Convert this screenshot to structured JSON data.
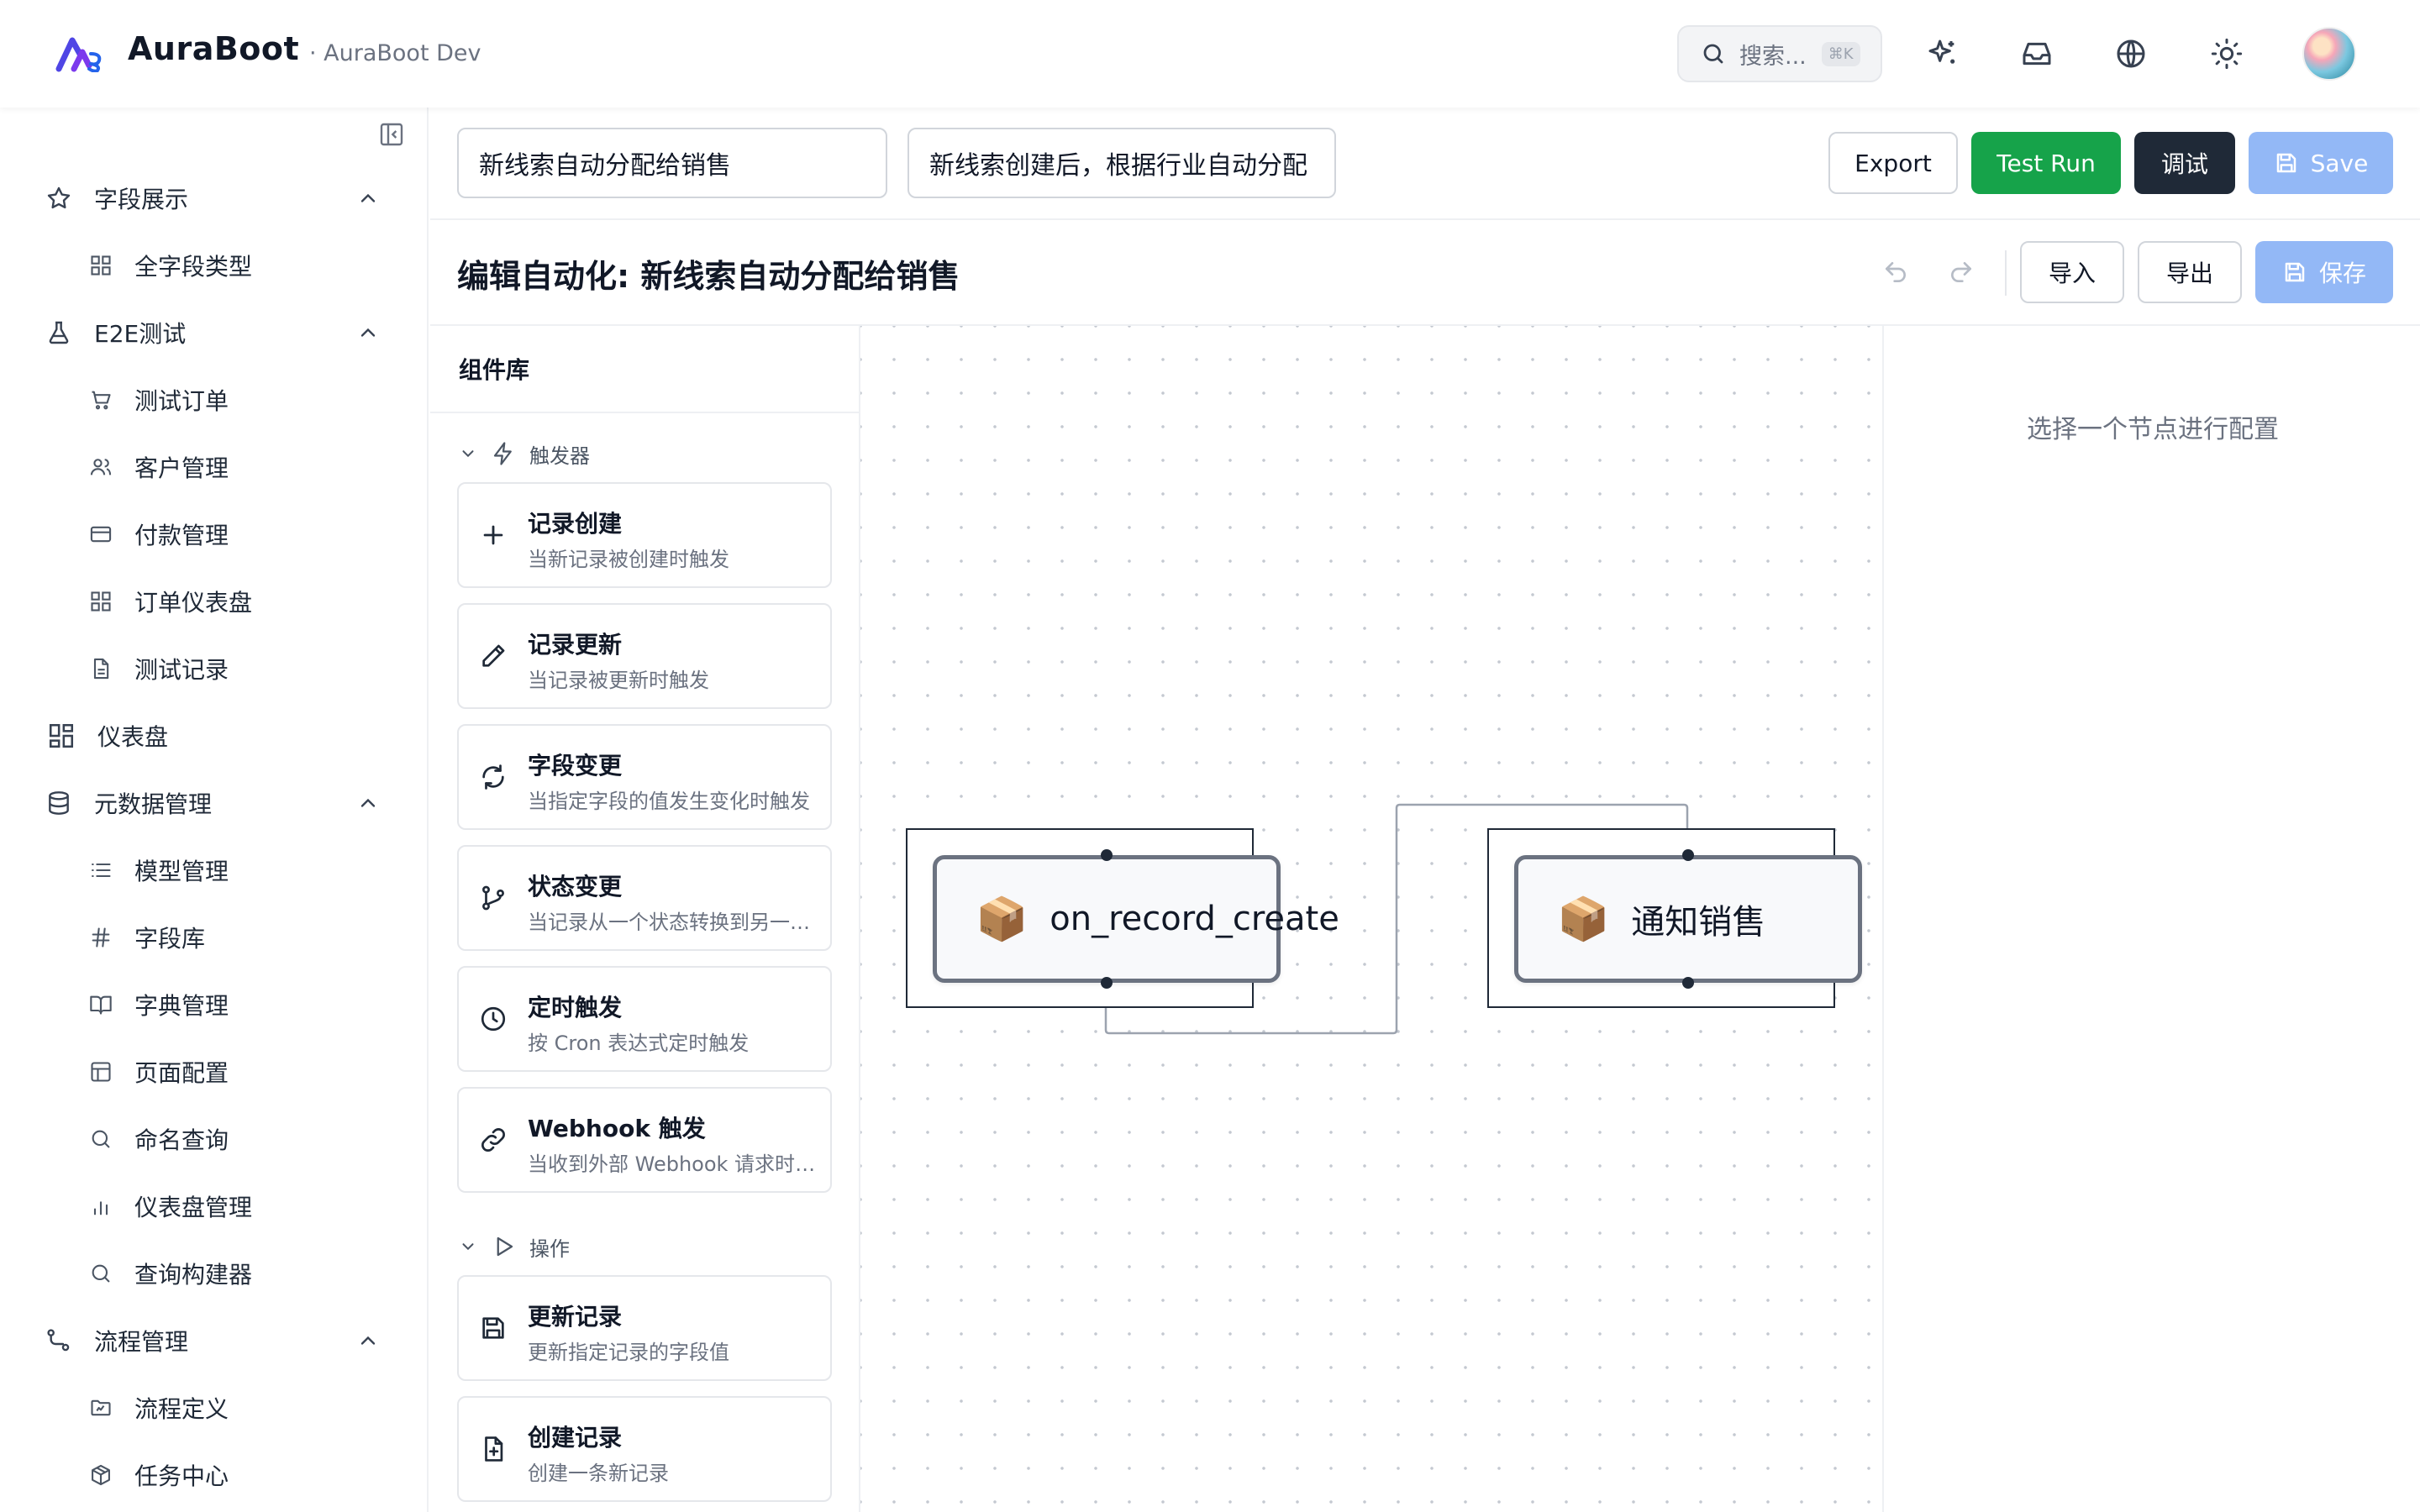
{
  "header": {
    "brand": "AuraBoot",
    "env": "· AuraBoot Dev",
    "search_placeholder": "搜索...",
    "search_shortcut": "⌘K",
    "icons": [
      "sparkles-icon",
      "inbox-icon",
      "globe-icon",
      "sun-icon"
    ],
    "colors": {
      "accent": "#16a34a",
      "brand_logo": "#4f46e5"
    }
  },
  "sidebar": {
    "items": [
      {
        "label": "字段展示",
        "icon": "star-icon",
        "kind": "group",
        "expanded": true
      },
      {
        "label": "全字段类型",
        "icon": "grid-icon",
        "kind": "sub"
      },
      {
        "label": "E2E测试",
        "icon": "flask-icon",
        "kind": "group",
        "expanded": true
      },
      {
        "label": "测试订单",
        "icon": "cart-icon",
        "kind": "sub"
      },
      {
        "label": "客户管理",
        "icon": "users-icon",
        "kind": "sub"
      },
      {
        "label": "付款管理",
        "icon": "credit-card-icon",
        "kind": "sub"
      },
      {
        "label": "订单仪表盘",
        "icon": "grid-icon",
        "kind": "sub"
      },
      {
        "label": "测试记录",
        "icon": "file-icon",
        "kind": "sub"
      },
      {
        "label": "仪表盘",
        "icon": "dashboard-icon",
        "kind": "top"
      },
      {
        "label": "元数据管理",
        "icon": "database-icon",
        "kind": "group",
        "expanded": true
      },
      {
        "label": "模型管理",
        "icon": "list-icon",
        "kind": "sub"
      },
      {
        "label": "字段库",
        "icon": "hash-icon",
        "kind": "sub"
      },
      {
        "label": "字典管理",
        "icon": "book-icon",
        "kind": "sub"
      },
      {
        "label": "页面配置",
        "icon": "layout-icon",
        "kind": "sub"
      },
      {
        "label": "命名查询",
        "icon": "search-icon",
        "kind": "sub"
      },
      {
        "label": "仪表盘管理",
        "icon": "bar-chart-icon",
        "kind": "sub"
      },
      {
        "label": "查询构建器",
        "icon": "search-icon",
        "kind": "sub"
      },
      {
        "label": "流程管理",
        "icon": "workflow-icon",
        "kind": "group",
        "expanded": true
      },
      {
        "label": "流程定义",
        "icon": "folder-icon",
        "kind": "sub"
      },
      {
        "label": "任务中心",
        "icon": "package-icon",
        "kind": "sub"
      }
    ]
  },
  "toolbar": {
    "name_value": "新线索自动分配给销售",
    "desc_value": "新线索创建后，根据行业自动分配",
    "export_label": "Export",
    "test_run_label": "Test Run",
    "debug_label": "调试",
    "save_label": "Save"
  },
  "editor": {
    "title": "编辑自动化: 新线索自动分配给销售",
    "import_label": "导入",
    "export_label": "导出",
    "save_label": "保存"
  },
  "library": {
    "title": "组件库",
    "sections": [
      {
        "title": "触发器",
        "icon": "zap-icon",
        "items": [
          {
            "title": "记录创建",
            "desc": "当新记录被创建时触发",
            "icon": "plus-icon"
          },
          {
            "title": "记录更新",
            "desc": "当记录被更新时触发",
            "icon": "pencil-icon"
          },
          {
            "title": "字段变更",
            "desc": "当指定字段的值发生变化时触发",
            "icon": "refresh-icon"
          },
          {
            "title": "状态变更",
            "desc": "当记录从一个状态转换到另一个状态时触发",
            "icon": "git-branch-icon"
          },
          {
            "title": "定时触发",
            "desc": "按 Cron 表达式定时触发",
            "icon": "clock-icon"
          },
          {
            "title": "Webhook 触发",
            "desc": "当收到外部 Webhook 请求时触发",
            "icon": "link-icon"
          }
        ]
      },
      {
        "title": "操作",
        "icon": "play-icon",
        "items": [
          {
            "title": "更新记录",
            "desc": "更新指定记录的字段值",
            "icon": "save-icon"
          },
          {
            "title": "创建记录",
            "desc": "创建一条新记录",
            "icon": "file-plus-icon"
          }
        ]
      }
    ]
  },
  "canvas": {
    "nodes": [
      {
        "id": "trigger",
        "emoji": "📦",
        "label": "on_record_create"
      },
      {
        "id": "action",
        "emoji": "📦",
        "label": "通知销售"
      }
    ]
  },
  "properties": {
    "hint": "选择一个节点进行配置"
  }
}
